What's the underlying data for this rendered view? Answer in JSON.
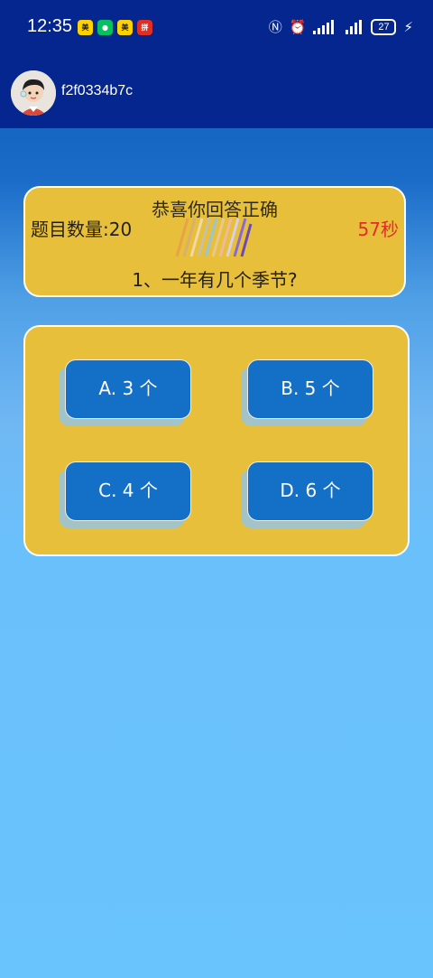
{
  "status": {
    "time": "12:35",
    "battery": "27",
    "app_badges": [
      {
        "icon": "meituan-icon",
        "label": "美团",
        "bg": "#ffd100",
        "fg": "#222"
      },
      {
        "icon": "wechat-icon",
        "label": "",
        "bg": "#07c160",
        "fg": "#fff"
      },
      {
        "icon": "meituan-icon",
        "label": "美团",
        "bg": "#ffd100",
        "fg": "#222"
      },
      {
        "icon": "pinduoduo-icon",
        "label": "拼",
        "bg": "#e02e24",
        "fg": "#fff"
      }
    ]
  },
  "user": {
    "name": "f2f0334b7c"
  },
  "quiz": {
    "feedback": "恭喜你回答正确",
    "count_label": "题目数量:20",
    "timer": "57秒",
    "question": "1、一年有几个季节?"
  },
  "options": [
    {
      "label": "A. 3 个"
    },
    {
      "label": "B. 5 个"
    },
    {
      "label": "C. 4 个"
    },
    {
      "label": "D. 6 个"
    }
  ],
  "colors": {
    "header": "#05268e",
    "card": "#e7bf3b",
    "option": "#1470c7",
    "timer": "#e42b2b"
  }
}
